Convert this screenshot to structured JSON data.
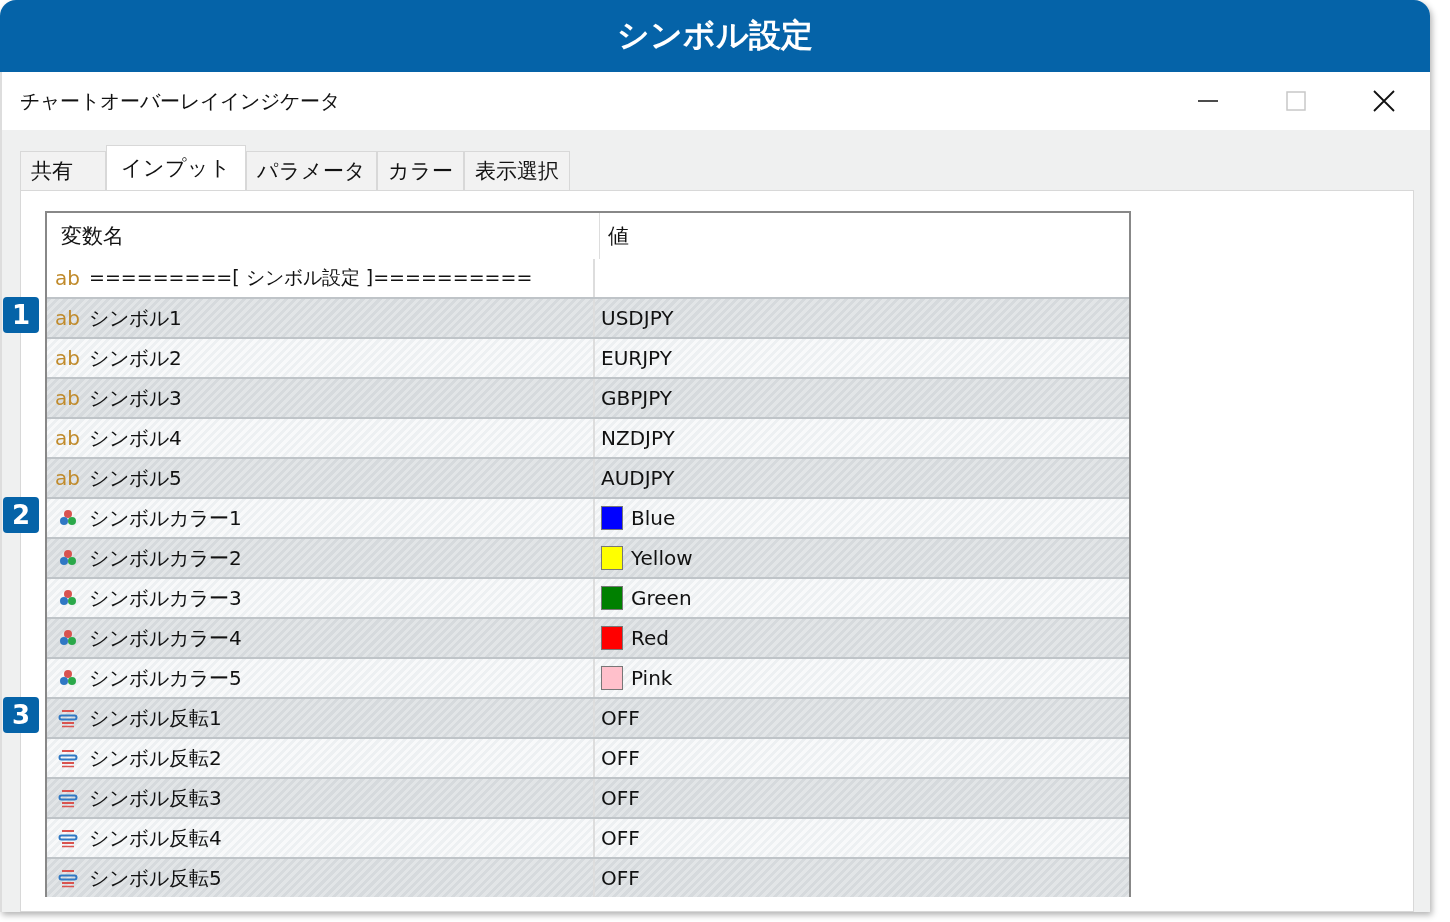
{
  "banner": {
    "title": "シンボル設定"
  },
  "window": {
    "title": "チャートオーバーレイインジケータ"
  },
  "tabs": [
    {
      "label": "共有",
      "selected": false
    },
    {
      "label": "インプット",
      "selected": true
    },
    {
      "label": "パラメータ",
      "selected": false
    },
    {
      "label": "カラー",
      "selected": false
    },
    {
      "label": "表示選択",
      "selected": false
    }
  ],
  "table": {
    "columns": [
      "変数名",
      "値"
    ],
    "rows": [
      {
        "kind": "separator",
        "type_label": "ab",
        "name": "=========[ シンボル設定 ]=========="
      },
      {
        "kind": "string",
        "badge": "1",
        "type_label": "ab",
        "name": "シンボル1",
        "value": "USDJPY"
      },
      {
        "kind": "string",
        "type_label": "ab",
        "name": "シンボル2",
        "value": "EURJPY"
      },
      {
        "kind": "string",
        "type_label": "ab",
        "name": "シンボル3",
        "value": "GBPJPY"
      },
      {
        "kind": "string",
        "type_label": "ab",
        "name": "シンボル4",
        "value": "NZDJPY"
      },
      {
        "kind": "string",
        "type_label": "ab",
        "name": "シンボル5",
        "value": "AUDJPY"
      },
      {
        "kind": "color",
        "badge": "2",
        "name": "シンボルカラー1",
        "value": "Blue",
        "color": "#0000ff"
      },
      {
        "kind": "color",
        "name": "シンボルカラー2",
        "value": "Yellow",
        "color": "#ffff00"
      },
      {
        "kind": "color",
        "name": "シンボルカラー3",
        "value": "Green",
        "color": "#008000"
      },
      {
        "kind": "color",
        "name": "シンボルカラー4",
        "value": "Red",
        "color": "#ff0000"
      },
      {
        "kind": "color",
        "name": "シンボルカラー5",
        "value": "Pink",
        "color": "#ffc0cb"
      },
      {
        "kind": "toggle",
        "badge": "3",
        "name": "シンボル反転1",
        "value": "OFF"
      },
      {
        "kind": "toggle",
        "name": "シンボル反転2",
        "value": "OFF"
      },
      {
        "kind": "toggle",
        "name": "シンボル反転3",
        "value": "OFF"
      },
      {
        "kind": "toggle",
        "name": "シンボル反転4",
        "value": "OFF"
      },
      {
        "kind": "toggle",
        "name": "シンボル反転5",
        "value": "OFF"
      }
    ]
  }
}
